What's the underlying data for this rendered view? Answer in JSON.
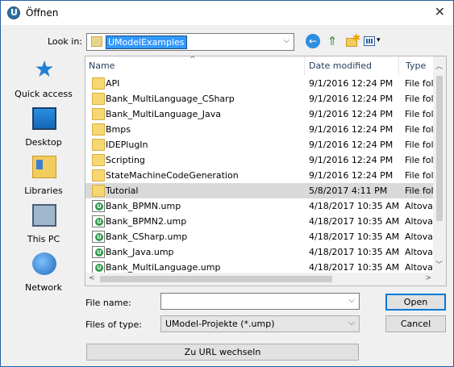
{
  "window": {
    "title": "Öffnen",
    "icon": "umodel-app-icon"
  },
  "toolbar": {
    "look_in_label": "Look in:",
    "look_in_value": "UModelExamples",
    "buttons": [
      {
        "name": "back-icon",
        "glyph": "←"
      },
      {
        "name": "up-folder-icon",
        "glyph": "⇑"
      },
      {
        "name": "new-folder-icon",
        "glyph": "✱"
      },
      {
        "name": "view-menu-icon",
        "glyph": "▾"
      }
    ]
  },
  "places": [
    {
      "label": "Quick access",
      "icon": "quick-access-icon"
    },
    {
      "label": "Desktop",
      "icon": "desktop-icon"
    },
    {
      "label": "Libraries",
      "icon": "libraries-icon"
    },
    {
      "label": "This PC",
      "icon": "this-pc-icon"
    },
    {
      "label": "Network",
      "icon": "network-icon"
    }
  ],
  "list": {
    "columns": [
      "Name",
      "Date modified",
      "Type"
    ],
    "rows": [
      {
        "name": "API",
        "date": "9/1/2016 12:24 PM",
        "type": "File fol",
        "kind": "folder"
      },
      {
        "name": "Bank_MultiLanguage_CSharp",
        "date": "9/1/2016 12:24 PM",
        "type": "File fol",
        "kind": "folder"
      },
      {
        "name": "Bank_MultiLanguage_Java",
        "date": "9/1/2016 12:24 PM",
        "type": "File fol",
        "kind": "folder"
      },
      {
        "name": "Bmps",
        "date": "9/1/2016 12:24 PM",
        "type": "File fol",
        "kind": "folder"
      },
      {
        "name": "IDEPlugIn",
        "date": "9/1/2016 12:24 PM",
        "type": "File fol",
        "kind": "folder"
      },
      {
        "name": "Scripting",
        "date": "9/1/2016 12:24 PM",
        "type": "File fol",
        "kind": "folder"
      },
      {
        "name": "StateMachineCodeGeneration",
        "date": "9/1/2016 12:24 PM",
        "type": "File fol",
        "kind": "folder"
      },
      {
        "name": "Tutorial",
        "date": "5/8/2017 4:11 PM",
        "type": "File fol",
        "kind": "folder",
        "selected": true
      },
      {
        "name": "Bank_BPMN.ump",
        "date": "4/18/2017 10:35 AM",
        "type": "Altova",
        "kind": "ump"
      },
      {
        "name": "Bank_BPMN2.ump",
        "date": "4/18/2017 10:35 AM",
        "type": "Altova",
        "kind": "ump"
      },
      {
        "name": "Bank_CSharp.ump",
        "date": "4/18/2017 10:35 AM",
        "type": "Altova",
        "kind": "ump"
      },
      {
        "name": "Bank_Java.ump",
        "date": "4/18/2017 10:35 AM",
        "type": "Altova",
        "kind": "ump"
      },
      {
        "name": "Bank_MultiLanguage.ump",
        "date": "4/18/2017 10:35 AM",
        "type": "Altova",
        "kind": "ump"
      }
    ]
  },
  "form": {
    "file_name_label": "File name:",
    "file_name_value": "",
    "file_type_label": "Files of type:",
    "file_type_value": "UModel-Projekte (*.ump)"
  },
  "buttons": {
    "open": "Open",
    "cancel": "Cancel",
    "url": "Zu URL wechseln"
  }
}
